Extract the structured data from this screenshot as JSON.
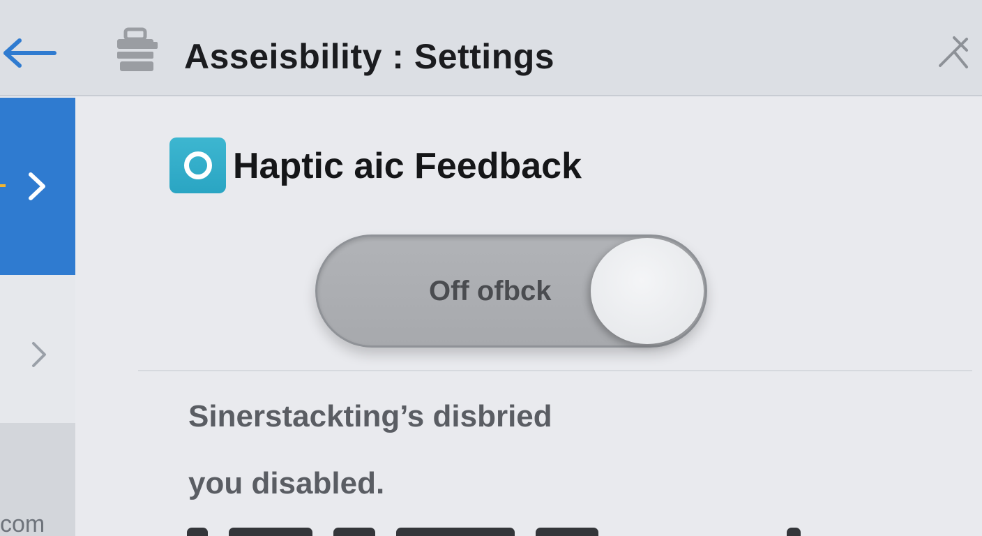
{
  "header": {
    "title": "Asseisbility : Settings"
  },
  "sidebar": {
    "bottom_text": "com"
  },
  "section": {
    "title": "Haptic aic Feedback"
  },
  "toggle": {
    "label": "Off ofbck",
    "state": "off"
  },
  "description": {
    "line1": "Sinerstackting’s disbried",
    "line2": "you disabled."
  },
  "colors": {
    "accent_blue": "#2f7bd0",
    "icon_teal": "#3db6d0",
    "sidebar_accent": "#f2b531"
  },
  "icons": {
    "back": "arrow-left-icon",
    "header": "printer-icon",
    "close": "close-icon",
    "section": "haptic-icon",
    "chevron": "chevron-right-icon"
  }
}
